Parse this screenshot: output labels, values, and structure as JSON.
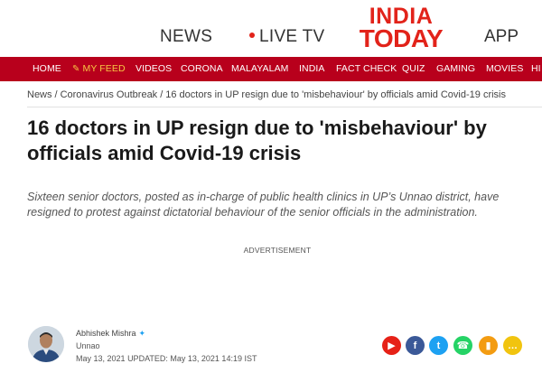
{
  "top": {
    "news": "NEWS",
    "live_tv": "LIVE TV",
    "logo_line1": "INDIA",
    "logo_line2": "TODAY",
    "app": "APP"
  },
  "nav": {
    "items": [
      "HOME",
      "MY FEED",
      "VIDEOS",
      "CORONA",
      "MALAYALAM",
      "INDIA",
      "FACT CHECK",
      "QUIZ",
      "GAMING",
      "MOVIES",
      "HI"
    ],
    "bg_color": "#b8001c",
    "highlight_color": "#f7c744"
  },
  "breadcrumb": {
    "items": [
      "News",
      "Coronavirus Outbreak",
      "16 doctors in UP resign due to 'misbehaviour' by officials amid Covid-19 crisis"
    ],
    "separator": "/"
  },
  "article": {
    "headline": "16 doctors in UP resign due to 'misbehaviour' by officials amid Covid-19 crisis",
    "summary": "Sixteen senior doctors, posted as in-charge of public health clinics in UP’s Unnao district, have resigned to protest against dictatorial behaviour of the senior officials in the administration.",
    "advertisement": "ADVERTISEMENT"
  },
  "author": {
    "name": "Abhishek Mishra",
    "location": "Unnao",
    "published": "May 13, 2021",
    "updated": "UPDATED: May 13, 2021 14:19 IST"
  },
  "share": [
    {
      "icon": "youtube-icon",
      "glyph": "▶",
      "color": "#e62117"
    },
    {
      "icon": "facebook-icon",
      "glyph": "f",
      "color": "#3b5998"
    },
    {
      "icon": "twitter-icon",
      "glyph": "t",
      "color": "#1da1f2"
    },
    {
      "icon": "whatsapp-icon",
      "glyph": "☎",
      "color": "#25d366"
    },
    {
      "icon": "bookmark-icon",
      "glyph": "▮",
      "color": "#f39c12"
    },
    {
      "icon": "comment-icon",
      "glyph": "…",
      "color": "#f1c40f"
    }
  ]
}
